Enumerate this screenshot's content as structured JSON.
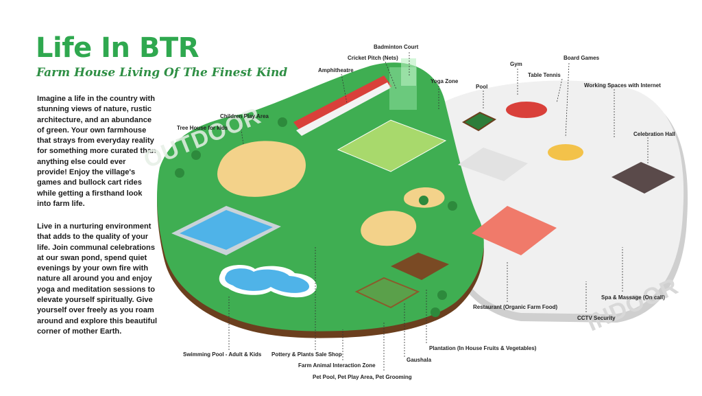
{
  "header": {
    "title": "Life In BTR",
    "subtitle": "Farm House Living Of The Finest Kind"
  },
  "intro": {
    "paragraph1": "Imagine a life in the country with stunning views of nature, rustic architecture, and an abundance of green. Your own farmhouse that strays from everyday reality for something more curated than anything else could ever provide! Enjoy the village's games and bullock cart rides while getting a firsthand look into farm life.",
    "paragraph2": "Live in a nurturing environment that adds to the quality of your life. Join communal celebrations at our swan pond, spend quiet evenings by your own fire with nature all around you and enjoy yoga and meditation sessions to elevate yourself spiritually. Give yourself over freely as you roam around and explore this beautiful corner of mother Earth."
  },
  "zones": {
    "outdoor": "OUTDOOR",
    "indoor": "INDOOR"
  },
  "labels": {
    "badminton_court": "Badminton Court",
    "cricket_pitch": "Cricket Pitch (Nets)",
    "amphitheatre": "Amphitheatre",
    "yoga_zone": "Yoga Zone",
    "children_play_area": "Children Play Area",
    "tree_house": "Tree House for kids",
    "pool": "Pool",
    "gym": "Gym",
    "table_tennis": "Table Tennis",
    "board_games": "Board Games",
    "working_spaces": "Working Spaces with Internet",
    "celebration_hall": "Celebration Hall",
    "restaurant": "Restaurant (Organic Farm Food)",
    "spa": "Spa & Massage (On call)",
    "cctv": "CCTV Security",
    "swimming_pool": "Swimming Pool - Adult & Kids",
    "pottery": "Pottery & Plants Sale Shop",
    "farm_animal": "Farm Animal Interaction Zone",
    "pet_pool": "Pet Pool, Pet Play Area, Pet Grooming",
    "gaushala": "Gaushala",
    "plantation": "Plantation (In House Fruits & Vegetables)"
  },
  "colors": {
    "brand_green": "#2fa84f",
    "lawn_green": "#3fae52",
    "soil_brown": "#6b3f1e",
    "indoor_floor": "#eeeeee",
    "sand": "#f3d28a",
    "water_blue": "#4fb3e8",
    "restaurant_red": "#f07a6a"
  }
}
